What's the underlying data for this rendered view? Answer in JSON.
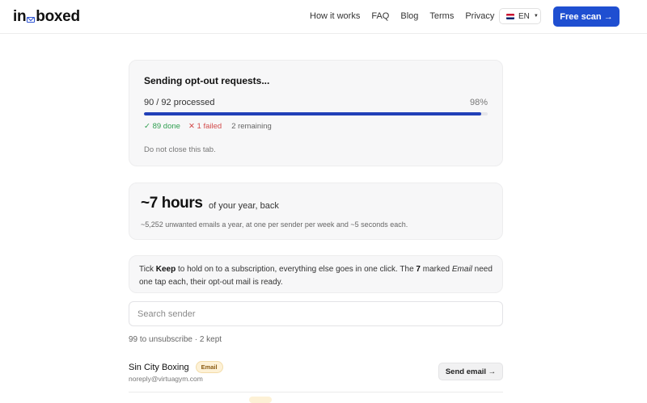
{
  "header": {
    "logo_prefix": "in",
    "logo_suffix": "boxed",
    "nav": [
      "How it works",
      "FAQ",
      "Blog",
      "Terms",
      "Privacy"
    ],
    "lang": "EN",
    "cta": "Free scan →"
  },
  "progress": {
    "title": "Sending opt-out requests...",
    "count": "90 / 92 processed",
    "percent_label": "98%",
    "percent": 98,
    "done": "✓ 89 done",
    "failed": "✕ 1 failed",
    "remaining": "2 remaining",
    "note": "Do not close this tab."
  },
  "savings": {
    "big": "~7 hours",
    "sub": "of your year, back",
    "detail": "~5,252 unwanted emails a year, at one per sender per week and ~5 seconds each."
  },
  "tip": {
    "t1": "Tick ",
    "keep": "Keep",
    "t2": " to hold on to a subscription, everything else goes in one click. The ",
    "num": "7",
    "t3": " marked ",
    "email": "Email",
    "t4": " need one tap each, their opt-out mail is ready."
  },
  "search": {
    "placeholder": "Search sender"
  },
  "summary": "99 to unsubscribe · 2 kept",
  "rows": [
    {
      "name": "Sin City Boxing",
      "badge": "Email",
      "address": "noreply@virtuagym.com",
      "action": "Send email →"
    }
  ],
  "colors": {
    "accent": "#1f4fd1",
    "progress": "#2140b8",
    "done": "#2e9e4f",
    "failed": "#d24b4b",
    "badge_bg": "#fdf1d6"
  }
}
